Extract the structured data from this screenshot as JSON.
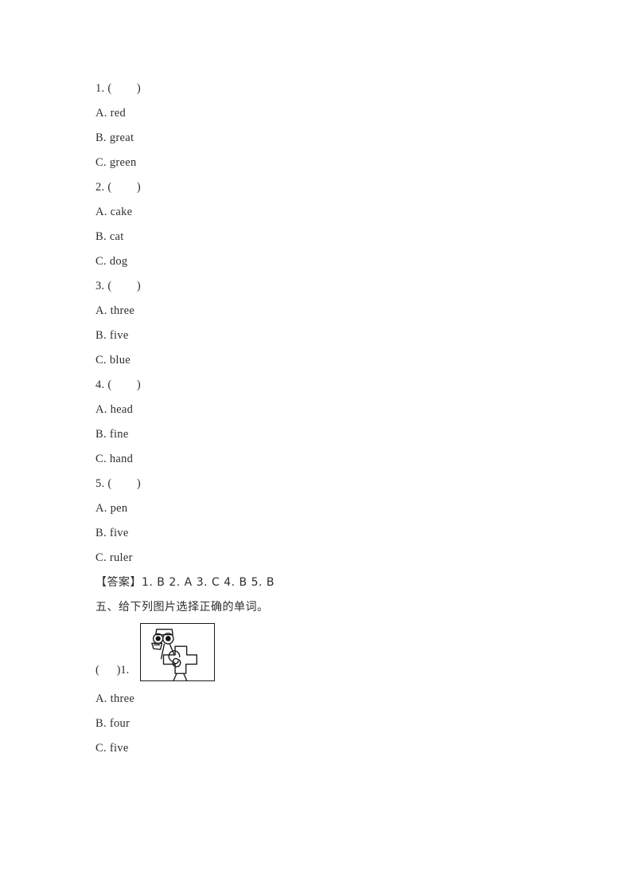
{
  "document": {
    "type": "scanned-worksheet",
    "language": "zh-CN/en",
    "text_color": "#2e2e2e",
    "background_color": "#ffffff"
  },
  "listening_section": {
    "questions": [
      {
        "number": "1. (        )",
        "options": [
          "A. red",
          "B. great",
          "C. green"
        ]
      },
      {
        "number": "2. (        )",
        "options": [
          "A. cake",
          "B. cat",
          "C. dog"
        ]
      },
      {
        "number": "3. (        )",
        "options": [
          "A. three",
          "B. five",
          "C. blue"
        ]
      },
      {
        "number": "4. (        )",
        "options": [
          "A. head",
          "B. fine",
          "C. hand"
        ]
      },
      {
        "number": "5. (        )",
        "options": [
          "A. pen",
          "B. five",
          "C. ruler"
        ]
      }
    ]
  },
  "answer_key": {
    "label": "【答案】",
    "answers": "1. B 2. A 3. C 4. B 5. B",
    "full": "【答案】1. B 2. A 3. C 4. B 5. B"
  },
  "picture_section": {
    "heading": "五、给下列图片选择正确的单词。",
    "item": {
      "bracket_label": "(      )1.",
      "picture_alt": "cartoon-figure-line-drawing",
      "options": [
        "A. three",
        "B. four",
        "C. five"
      ]
    }
  }
}
